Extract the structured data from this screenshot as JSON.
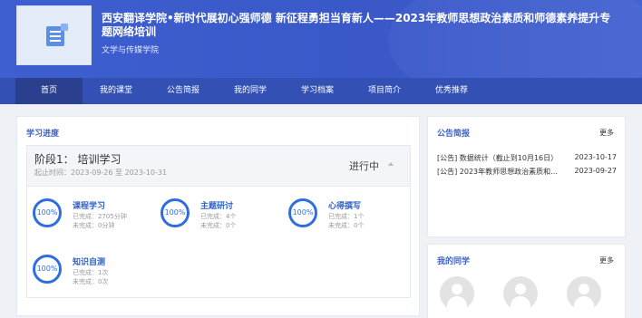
{
  "header": {
    "title": "西安翻译学院•新时代展初心强师德 新征程勇担当育新人——2023年教师思想政治素质和师德素养提升专题网络培训",
    "subtitle": "文学与传媒学院"
  },
  "nav": {
    "items": [
      {
        "label": "首页"
      },
      {
        "label": "我的课堂"
      },
      {
        "label": "公告简报"
      },
      {
        "label": "我的同学"
      },
      {
        "label": "学习档案"
      },
      {
        "label": "项目简介"
      },
      {
        "label": "优秀推荐"
      }
    ]
  },
  "progress": {
    "section_title": "学习进度",
    "stage_name": "阶段1： 培训学习",
    "stage_time": "起止时间：2023-09-26 至 2023-10-31",
    "status": "进行中",
    "tasks": [
      {
        "name": "课程学习",
        "percent": "100%",
        "line1": "已完成：2705分钟",
        "line2": "未完成：0分钟"
      },
      {
        "name": "主题研讨",
        "percent": "100%",
        "line1": "已完成：4个",
        "line2": "未完成：0个"
      },
      {
        "name": "心得撰写",
        "percent": "100%",
        "line1": "已完成：1个",
        "line2": "未完成：0个"
      },
      {
        "name": "知识自测",
        "percent": "100%",
        "line1": "已完成：1次",
        "line2": "未完成：0次"
      }
    ]
  },
  "announcements": {
    "title": "公告简报",
    "more": "更多",
    "items": [
      {
        "title": "[公告] 数据统计（截止到10月16日）",
        "date": "2023-10-17"
      },
      {
        "title": "[公告] 2023年教师思想政治素质和师...",
        "date": "2023-09-27"
      }
    ]
  },
  "classmates": {
    "title": "我的同学",
    "more": "更多"
  },
  "colors": {
    "header_bg": "#3d5fd0",
    "nav_bg": "#3350b4",
    "nav_active": "#2a3f8e",
    "accent": "#2f6ee0"
  },
  "icons": [
    "course-book-icon",
    "collapse-caret-icon",
    "avatar-placeholder-icon"
  ]
}
